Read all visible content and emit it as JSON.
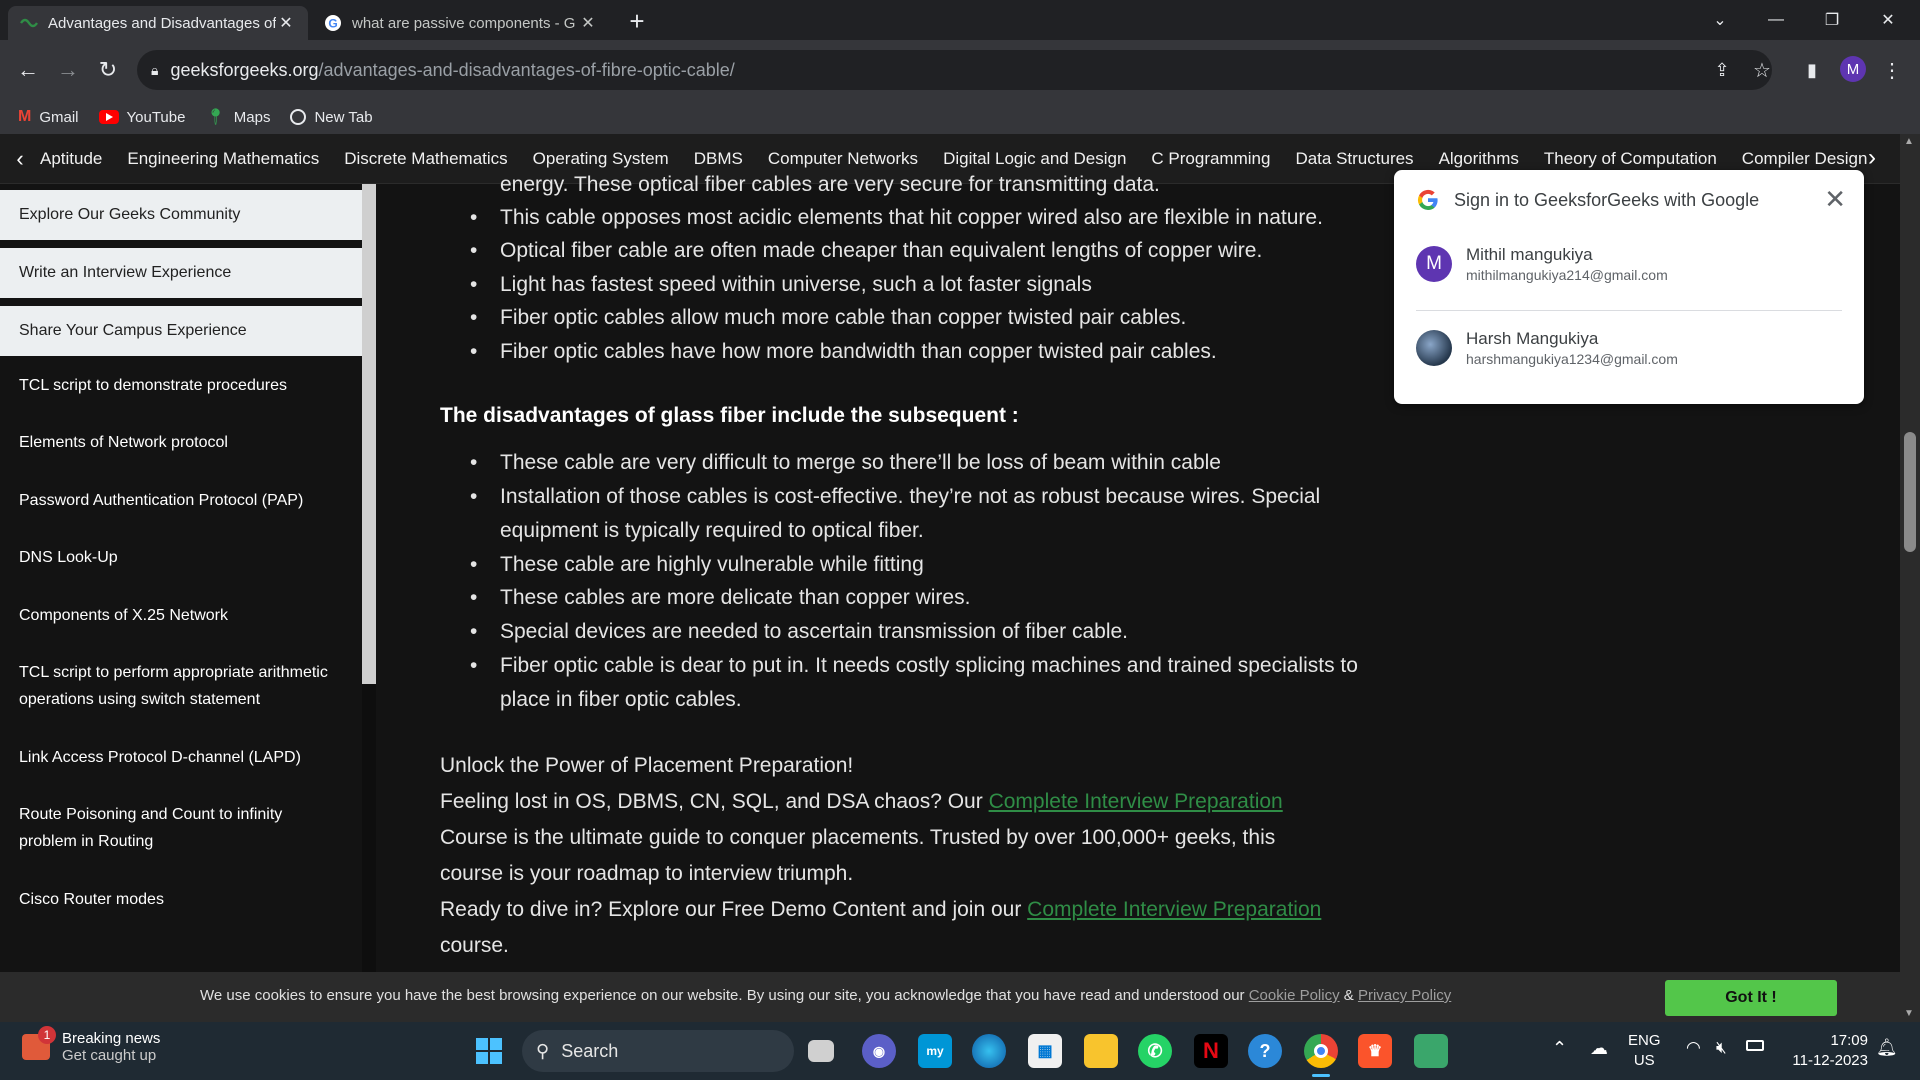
{
  "browser": {
    "tabs": [
      {
        "title": "Advantages and Disadvantages of",
        "active": true
      },
      {
        "title": "what are passive components - G",
        "active": false
      }
    ],
    "url_host": "geeksforgeeks.org",
    "url_path": "/advantages-and-disadvantages-of-fibre-optic-cable/",
    "profile_initial": "M",
    "bookmarks": [
      {
        "label": "Gmail",
        "icon": "gmail-icon"
      },
      {
        "label": "YouTube",
        "icon": "youtube-icon"
      },
      {
        "label": "Maps",
        "icon": "maps-icon"
      },
      {
        "label": "New Tab",
        "icon": "globe-icon"
      }
    ]
  },
  "topnav": {
    "items": [
      "Aptitude",
      "Engineering Mathematics",
      "Discrete Mathematics",
      "Operating System",
      "DBMS",
      "Computer Networks",
      "Digital Logic and Design",
      "C Programming",
      "Data Structures",
      "Algorithms",
      "Theory of Computation",
      "Compiler Design"
    ]
  },
  "sidebar": {
    "items": [
      "Explore Our Geeks Community",
      "Write an Interview Experience",
      "Share Your Campus Experience",
      "TCL script to demonstrate procedures",
      "Elements of Network protocol",
      "Password Authentication Protocol (PAP)",
      "DNS Look-Up",
      "Components of X.25 Network",
      "TCL script to perform appropriate arithmetic",
      "operations using switch statement",
      "Link Access Protocol D-channel (LAPD)",
      "Route Poisoning and Count to infinity",
      "problem in Routing",
      "Cisco Router modes"
    ]
  },
  "article": {
    "cut_line": "energy. These optical fiber cables are very secure for transmitting data.",
    "advantages": [
      "This cable opposes most acidic elements that hit copper wired also are flexible in nature.",
      "Optical fiber cable are often made cheaper than equivalent lengths of copper wire.",
      "Light has fastest speed within universe, such a lot faster signals",
      "Fiber optic cables allow much more cable than copper twisted pair cables.",
      "Fiber optic cables have how more bandwidth than copper twisted pair cables."
    ],
    "disadv_heading": "The disadvantages of glass fiber include the subsequent :",
    "disadvantages": [
      {
        "l1": "These cable are very difficult to merge so there’ll be loss of beam within cable",
        "l2": ""
      },
      {
        "l1": "Installation of those cables is cost-effective. they’re not as robust because wires. Special",
        "l2": "equipment is typically required to optical fiber."
      },
      {
        "l1": "These cable are highly vulnerable while fitting",
        "l2": ""
      },
      {
        "l1": "These cables are more delicate than copper wires.",
        "l2": ""
      },
      {
        "l1": "Special devices are needed to ascertain transmission of fiber cable.",
        "l2": ""
      },
      {
        "l1": "Fiber optic cable is dear to put in. It needs costly splicing machines and trained specialists to",
        "l2": "place in fiber optic cables."
      }
    ],
    "promo": {
      "line1": "Unlock the Power of Placement Preparation!",
      "line2_pre": "Feeling lost in OS, DBMS, CN, SQL, and DSA chaos? Our ",
      "link": "Complete Interview Preparation",
      "line3": "Course is the ultimate guide to conquer placements. Trusted by over 100,000+ geeks, this",
      "line4": "course is your roadmap to interview triumph.",
      "line5_pre": "Ready to dive in? Explore our Free Demo Content and join our ",
      "line6": "course."
    }
  },
  "google_signin": {
    "title": "Sign in to GeeksforGeeks with Google",
    "accounts": [
      {
        "name": "Mithil mangukiya",
        "email": "mithilmangukiya214@gmail.com",
        "initial": "M"
      },
      {
        "name": "Harsh Mangukiya",
        "email": "harshmangukiya1234@gmail.com",
        "initial": ""
      }
    ]
  },
  "cookie": {
    "text": "We use cookies to ensure you have the best browsing experience on our website. By using our site, you acknowledge that you have read and understood our ",
    "cookie_policy": "Cookie Policy",
    "amp": " & ",
    "privacy_policy": "Privacy Policy",
    "button": "Got It !"
  },
  "taskbar": {
    "news_title": "Breaking news",
    "news_sub": "Get caught up",
    "news_badge": "1",
    "search_label": "Search",
    "lang1": "ENG",
    "lang2": "US",
    "time": "17:09",
    "date": "11-12-2023"
  },
  "colors": {
    "gfg_green": "#2f8d46",
    "got_it_green": "#53c64a",
    "chrome_dark": "#35363a"
  }
}
